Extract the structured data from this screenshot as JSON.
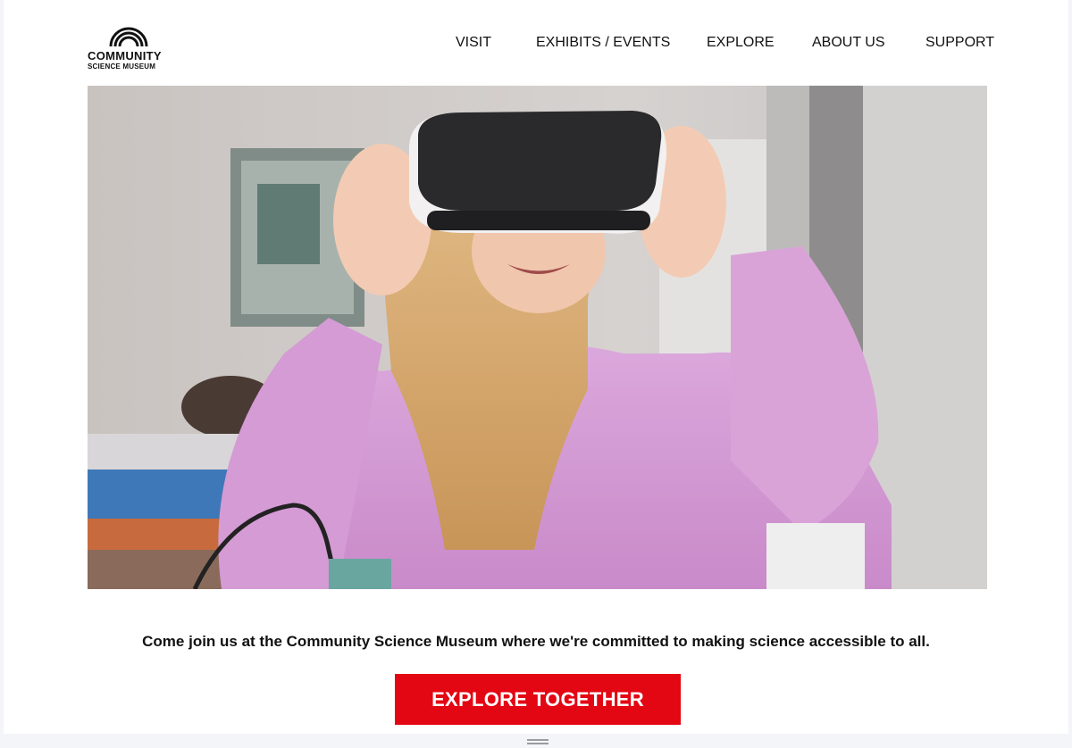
{
  "brand": {
    "line1": "COMMUNITY",
    "line2": "SCIENCE MUSEUM",
    "logo_icon": "concentric-arcs-logo"
  },
  "nav": {
    "items": [
      {
        "label": "VISIT"
      },
      {
        "label": "EXHIBITS / EVENTS"
      },
      {
        "label": "EXPLORE"
      },
      {
        "label": "ABOUT US"
      },
      {
        "label": "SUPPORT"
      }
    ]
  },
  "hero": {
    "image": "girl-wearing-vr-headset-photo"
  },
  "main": {
    "tagline": "Come join us at the Community Science Museum where we're committed to making science accessible to all.",
    "cta_label": "EXPLORE TOGETHER"
  },
  "colors": {
    "accent": "#e30613",
    "text": "#111111",
    "background": "#ffffff"
  }
}
